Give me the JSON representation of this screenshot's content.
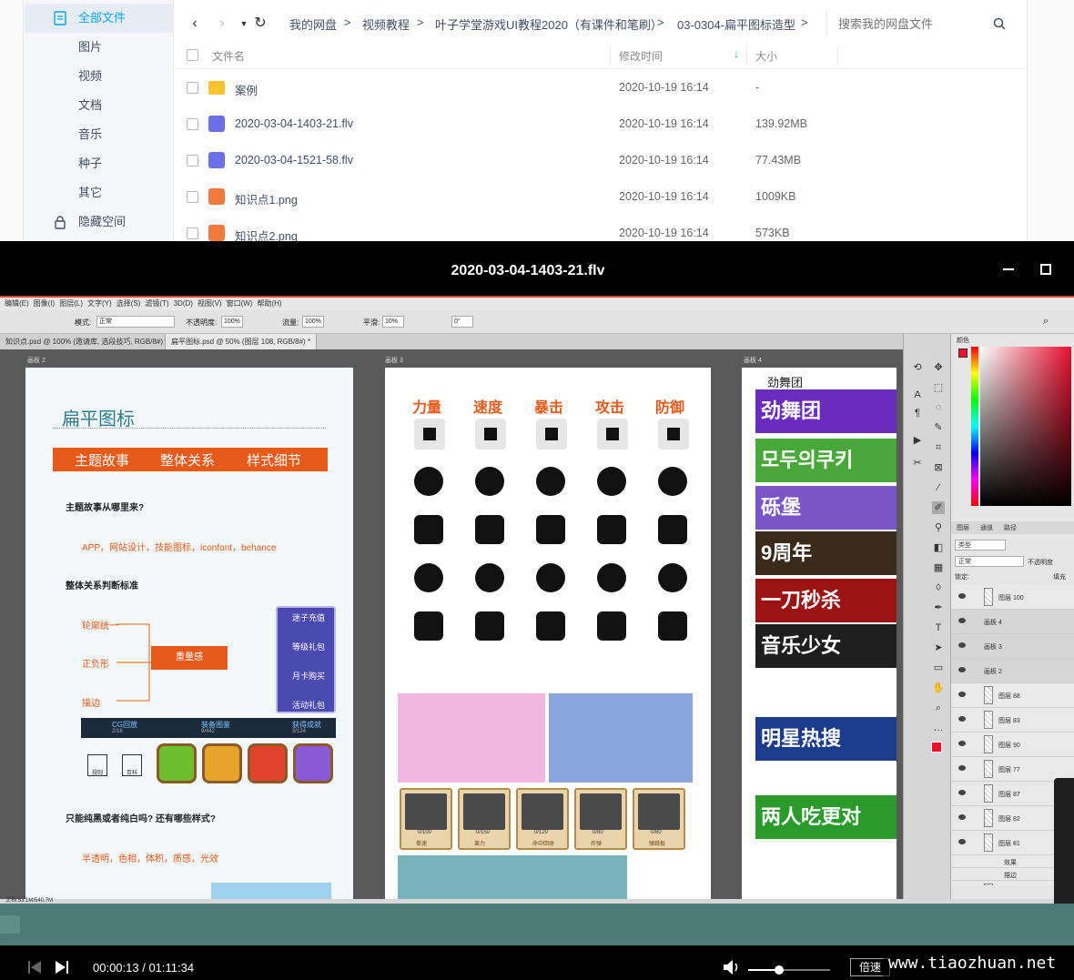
{
  "file_manager": {
    "sidebar": [
      {
        "label": "全部文件",
        "icon": "document-icon",
        "active": true
      },
      {
        "label": "图片"
      },
      {
        "label": "视频"
      },
      {
        "label": "文档"
      },
      {
        "label": "音乐"
      },
      {
        "label": "种子"
      },
      {
        "label": "其它"
      },
      {
        "label": "隐藏空间",
        "icon": "lock-icon"
      }
    ],
    "breadcrumb": [
      "我的网盘",
      "视频教程",
      "叶子学堂游戏UI教程2020（有课件和笔刷）",
      "03-0304-扁平图标造型"
    ],
    "separator": ">",
    "search_placeholder": "搜索我的网盘文件",
    "columns": {
      "name": "文件名",
      "modified": "修改时间",
      "size": "大小"
    },
    "files": [
      {
        "name": "案例",
        "date": "2020-10-19 16:14",
        "size": "-",
        "type": "folder",
        "color": "#f7c42d"
      },
      {
        "name": "2020-03-04-1403-21.flv",
        "date": "2020-10-19 16:14",
        "size": "139.92MB",
        "type": "video",
        "color": "#6a6ee8"
      },
      {
        "name": "2020-03-04-1521-58.flv",
        "date": "2020-10-19 16:14",
        "size": "77.43MB",
        "type": "video",
        "color": "#6a6ee8"
      },
      {
        "name": "知识点1.png",
        "date": "2020-10-19 16:14",
        "size": "1009KB",
        "type": "image",
        "color": "#f07a3c"
      },
      {
        "name": "知识点2.png",
        "date": "2020-10-19 16:14",
        "size": "573KB",
        "type": "image",
        "color": "#f07a3c"
      }
    ]
  },
  "player": {
    "title": "2020-03-04-1403-21.flv",
    "time": "00:00:13 / 01:11:34",
    "speed_label": "倍速",
    "volume": 0.38,
    "progress": 0.003,
    "watermark": "www.tiaozhuan.net"
  },
  "photoshop": {
    "menu": [
      "编辑(E)",
      "图像(I)",
      "图层(L)",
      "文字(Y)",
      "选择(S)",
      "滤镜(T)",
      "3D(D)",
      "视图(V)",
      "窗口(W)",
      "帮助(H)"
    ],
    "options": {
      "mode_label": "模式:",
      "mode_value": "正常",
      "opacity_label": "不透明度:",
      "opacity_value": "100%",
      "flow_label": "流量:",
      "flow_value": "100%",
      "smooth_label": "平滑:",
      "smooth_value": "10%",
      "angle_value": "0°"
    },
    "tabs": [
      "知识点.psd @ 100% (邀请库, 选段技巧, RGB/8#) *",
      "扁平图标.psd @ 50% (图层 108, RGB/8#) *"
    ],
    "artboard_labels": [
      "画板 2",
      "画板 3",
      "画板 4"
    ],
    "status": "文档:53.1M/540.7M",
    "panel_tabs": {
      "color": "颜色",
      "layers": "图层",
      "channels": "通道",
      "paths": "路径"
    },
    "layer_filter": "类型",
    "blend_mode": "正常",
    "opacity_short": "不透明度",
    "lock_label": "锁定:",
    "fill_label": "填充",
    "layers": [
      {
        "name": "图层 100"
      },
      {
        "name": "画板 4"
      },
      {
        "name": "画板 3"
      },
      {
        "name": "画板 2"
      },
      {
        "name": "图层 88"
      },
      {
        "name": "图层 83"
      },
      {
        "name": "图层 90"
      },
      {
        "name": "图层 77"
      },
      {
        "name": "图层 87"
      },
      {
        "name": "图层 82"
      },
      {
        "name": "图层 81"
      },
      {
        "name": "效果"
      },
      {
        "name": "描边"
      },
      {
        "name": "图层 80"
      }
    ]
  },
  "artboard2": {
    "title": "扁平图标",
    "bar": [
      "主题故事",
      "整体关系",
      "样式细节"
    ],
    "q1": "主题故事从哪里来?",
    "a1": "APP，网站设计，技能图标，iconfont，behance",
    "q2": "整体关系判断标准",
    "tree": [
      "轮廓统一",
      "正负形",
      "描边"
    ],
    "tree_result": "重量感",
    "menu_items": [
      "迷子充值",
      "等级礼包",
      "月卡购买",
      "活动礼包"
    ],
    "strip": [
      "CG回放",
      "装备图鉴",
      "获得成就"
    ],
    "strip_counts": [
      "2/16",
      "9/442",
      "3/124"
    ],
    "small_labels": [
      "规则",
      "百科"
    ],
    "q3": "只能纯黑或者纯白吗? 还有哪些样式?",
    "a3": "半透明，色相，体积，质感，光效"
  },
  "artboard3": {
    "headers": [
      "力量",
      "速度",
      "暴击",
      "攻击",
      "防御"
    ],
    "cards": [
      {
        "count": "0/100",
        "label": "拳速"
      },
      {
        "count": "0/150",
        "label": "蛮力"
      },
      {
        "count": "0/120",
        "label": "命中回体"
      },
      {
        "count": "0/80",
        "label": "炸弹"
      },
      {
        "count": "0/80",
        "label": "弹跳板"
      }
    ]
  },
  "artboard4": {
    "title": "劲舞团",
    "banners": [
      {
        "text": "劲舞团",
        "color": "#6a2bbf"
      },
      {
        "text": "모두의쿠키",
        "color": "#4aa83a"
      },
      {
        "text": "砾堡",
        "color": "#7a55c8"
      },
      {
        "text": "9周年",
        "color": "#3a2a1a"
      },
      {
        "text": "一刀秒杀",
        "color": "#9a1212"
      },
      {
        "text": "音乐少女",
        "color": "#1e1e1e"
      },
      {
        "text": "明星热搜",
        "color": "#1d3b8c"
      },
      {
        "text": "两人吃更对",
        "color": "#2a9a2a"
      }
    ]
  },
  "colors": {
    "accent": "#06a7ff",
    "orange": "#e85a19",
    "progress": "#4c7a76"
  }
}
